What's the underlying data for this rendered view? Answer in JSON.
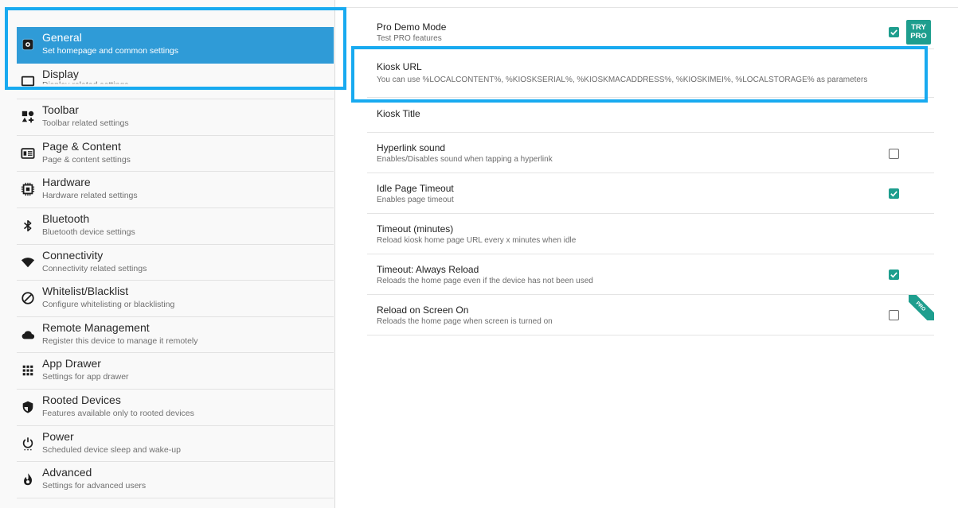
{
  "sidebar": {
    "items": [
      {
        "title": "General",
        "subtitle": "Set homepage and common settings",
        "icon": "gear-icon"
      },
      {
        "title": "Display",
        "subtitle": "Display related settings",
        "icon": "display-icon"
      },
      {
        "title": "Toolbar",
        "subtitle": "Toolbar related settings",
        "icon": "toolbar-icon"
      },
      {
        "title": "Page & Content",
        "subtitle": "Page & content settings",
        "icon": "page-content-icon"
      },
      {
        "title": "Hardware",
        "subtitle": "Hardware related settings",
        "icon": "chip-icon"
      },
      {
        "title": "Bluetooth",
        "subtitle": "Bluetooth device settings",
        "icon": "bluetooth-icon"
      },
      {
        "title": "Connectivity",
        "subtitle": "Connectivity related settings",
        "icon": "wifi-icon"
      },
      {
        "title": "Whitelist/Blacklist",
        "subtitle": "Configure whitelisting or blacklisting",
        "icon": "block-icon"
      },
      {
        "title": "Remote Management",
        "subtitle": "Register this device to manage it remotely",
        "icon": "cloud-icon"
      },
      {
        "title": "App Drawer",
        "subtitle": "Settings for app drawer",
        "icon": "grid-icon"
      },
      {
        "title": "Rooted Devices",
        "subtitle": "Features available only to rooted devices",
        "icon": "shield-icon"
      },
      {
        "title": "Power",
        "subtitle": "Scheduled device sleep and wake-up",
        "icon": "power-icon"
      },
      {
        "title": "Advanced",
        "subtitle": "Settings for advanced users",
        "icon": "flame-icon"
      }
    ]
  },
  "settings": {
    "pro_demo": {
      "title": "Pro Demo Mode",
      "subtitle": "Test PRO features",
      "checked": true,
      "badge_line1": "TRY",
      "badge_line2": "PRO"
    },
    "kiosk_url": {
      "title": "Kiosk URL",
      "subtitle": "You can use %LOCALCONTENT%, %KIOSKSERIAL%, %KIOSKMACADDRESS%, %KIOSKIMEI%, %LOCALSTORAGE% as parameters"
    },
    "kiosk_title": {
      "title": "Kiosk Title"
    },
    "hyperlink_sound": {
      "title": "Hyperlink sound",
      "subtitle": "Enables/Disables sound when tapping a hyperlink",
      "checked": false
    },
    "idle_timeout": {
      "title": "Idle Page Timeout",
      "subtitle": "Enables page timeout",
      "checked": true
    },
    "timeout_minutes": {
      "title": "Timeout (minutes)",
      "subtitle": "Reload kiosk home page URL every x minutes when idle"
    },
    "always_reload": {
      "title": "Timeout: Always Reload",
      "subtitle": "Reloads the home page even if the device has not been used",
      "checked": true
    },
    "reload_screen_on": {
      "title": "Reload on Screen On",
      "subtitle": "Reloads the home page when screen is turned on",
      "checked": false,
      "ribbon": "PRO"
    }
  },
  "colors": {
    "accent": "#2f9bd7",
    "checkbox": "#1e9e8e",
    "highlight": "#18aaf0"
  }
}
